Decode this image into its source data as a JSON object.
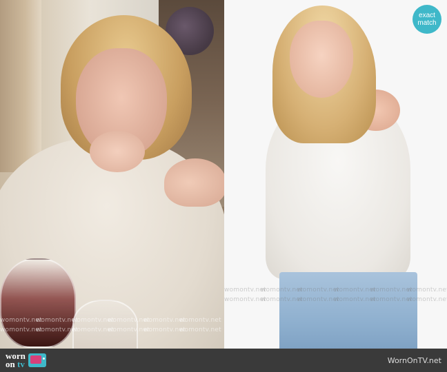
{
  "badge": {
    "line1": "exact",
    "line2": "match",
    "color": "#3fb8c9"
  },
  "watermark": {
    "text": "womontv.net"
  },
  "footer": {
    "logo_word1": "worn",
    "logo_word2": "on",
    "logo_word3": "tv",
    "logo_icon": "tv-icon",
    "site_name": "WornOnTV.net",
    "bar_color": "#3a3a3a",
    "accent_color": "#3fb8c9"
  }
}
